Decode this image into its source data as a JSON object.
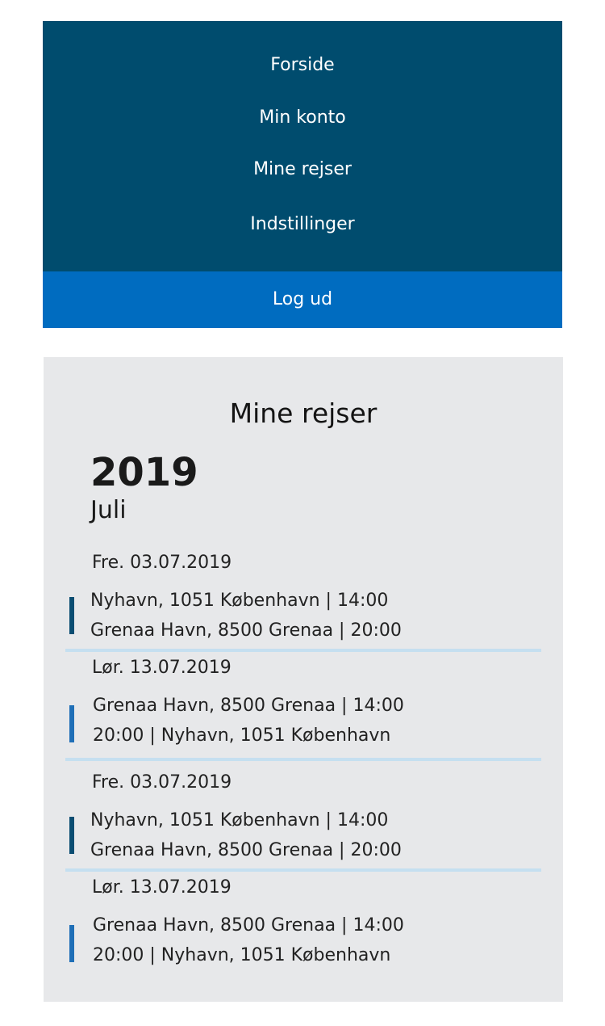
{
  "menu": {
    "items": [
      "Forside",
      "Min konto",
      "Mine rejser",
      "Indstillinger"
    ],
    "logout": "Log ud",
    "bg_color": "#004c6e",
    "logout_color": "#006cc0"
  },
  "panel": {
    "title": "Mine rejser",
    "year": "2019",
    "month": "Juli",
    "trips": [
      {
        "date": "Fre. 03.07.2019",
        "line1": "Nyhavn, 1051 København  |  14:00",
        "line2": "Grenaa Havn, 8500 Grenaa  |  20:00",
        "accent": "dark"
      },
      {
        "date": "Lør. 13.07.2019",
        "line1": "Grenaa Havn, 8500 Grenaa  |  14:00",
        "line2": "20:00  |  Nyhavn, 1051 København",
        "accent": "light"
      },
      {
        "date": "Fre. 03.07.2019",
        "line1": "Nyhavn, 1051 København  |  14:00",
        "line2": "Grenaa Havn, 8500 Grenaa  |  20:00",
        "accent": "dark"
      },
      {
        "date": "Lør. 13.07.2019",
        "line1": "Grenaa Havn, 8500 Grenaa  |  14:00",
        "line2": "20:00  |  Nyhavn, 1051 København",
        "accent": "light"
      }
    ]
  }
}
